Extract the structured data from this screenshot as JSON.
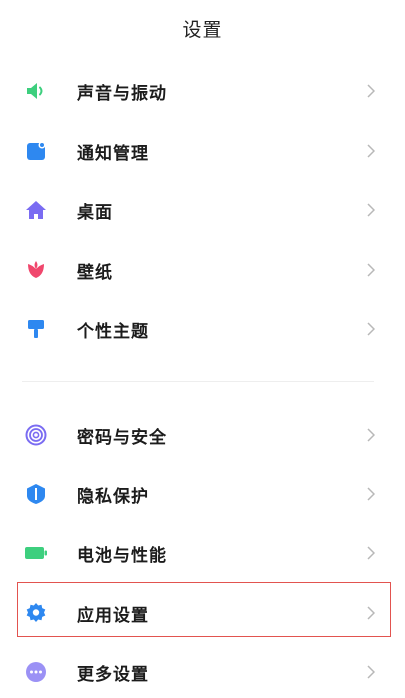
{
  "header": {
    "title": "设置"
  },
  "group1": {
    "sound": {
      "label": "声音与振动",
      "icon": "speaker-icon"
    },
    "notify": {
      "label": "通知管理",
      "icon": "notification-icon"
    },
    "desktop": {
      "label": "桌面",
      "icon": "home-icon"
    },
    "wallpaper": {
      "label": "壁纸",
      "icon": "flower-icon"
    },
    "theme": {
      "label": "个性主题",
      "icon": "paintbrush-icon"
    }
  },
  "group2": {
    "password": {
      "label": "密码与安全",
      "icon": "fingerprint-icon"
    },
    "privacy": {
      "label": "隐私保护",
      "icon": "shield-icon"
    },
    "battery": {
      "label": "电池与性能",
      "icon": "battery-icon"
    },
    "apps": {
      "label": "应用设置",
      "icon": "gear-icon"
    },
    "more": {
      "label": "更多设置",
      "icon": "more-icon"
    }
  },
  "colors": {
    "sound": "#3dcf7e",
    "notify": "#2e88f0",
    "desktop": "#7a6cf2",
    "wallpaper": "#f0476d",
    "theme": "#2e88f0",
    "password": "#7a6cf2",
    "privacy": "#2e88f0",
    "battery": "#3dcf7e",
    "apps": "#2e88f0",
    "more": "#7a6cf2",
    "highlight": "#e2534f",
    "chevron": "#b8b8b8"
  },
  "highlighted_item": "应用设置"
}
